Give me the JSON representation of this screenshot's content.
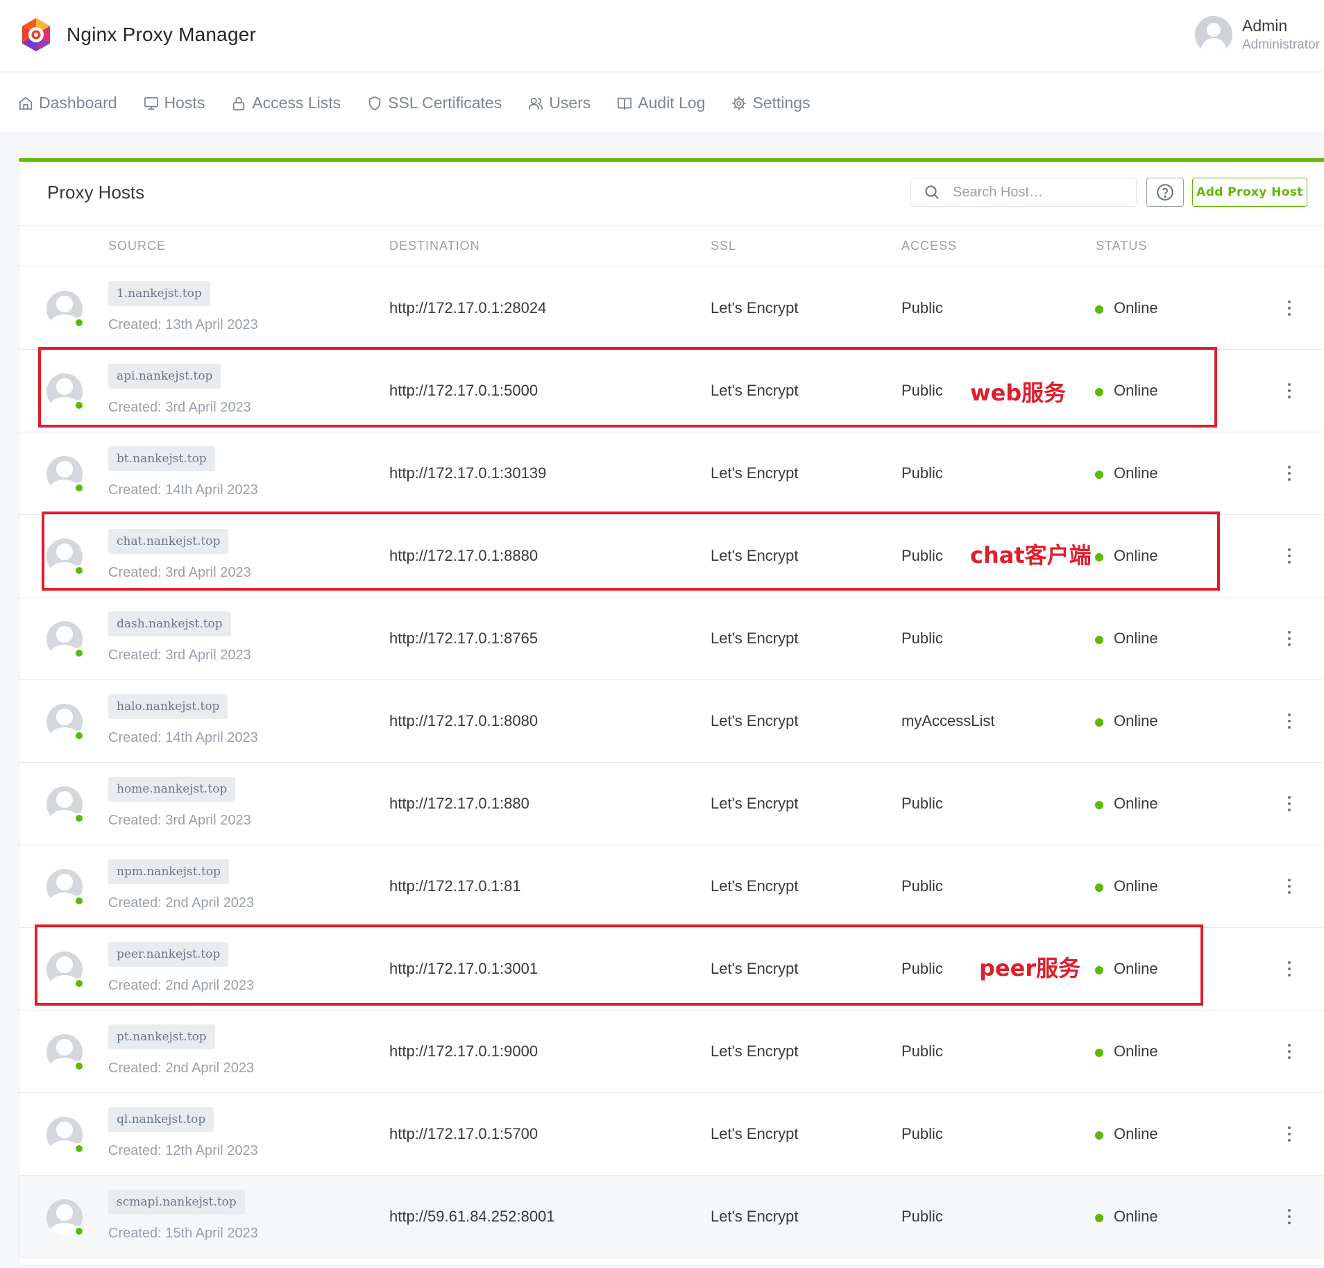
{
  "app": {
    "title": "Nginx Proxy Manager"
  },
  "user": {
    "name": "Admin",
    "role": "Administrator"
  },
  "nav": {
    "items": [
      {
        "label": "Dashboard",
        "icon": "home-icon"
      },
      {
        "label": "Hosts",
        "icon": "monitor-icon"
      },
      {
        "label": "Access Lists",
        "icon": "lock-icon"
      },
      {
        "label": "SSL Certificates",
        "icon": "shield-icon"
      },
      {
        "label": "Users",
        "icon": "users-icon"
      },
      {
        "label": "Audit Log",
        "icon": "book-icon"
      },
      {
        "label": "Settings",
        "icon": "gear-icon"
      }
    ]
  },
  "card": {
    "title": "Proxy Hosts",
    "search_placeholder": "Search Host…",
    "add_label": "Add Proxy Host"
  },
  "table": {
    "columns": [
      "SOURCE",
      "DESTINATION",
      "SSL",
      "ACCESS",
      "STATUS"
    ],
    "rows": [
      {
        "domain": "1.nankejst.top",
        "created": "Created: 13th April 2023",
        "destination": "http://172.17.0.1:28024",
        "ssl": "Let's Encrypt",
        "access": "Public",
        "status": "Online"
      },
      {
        "domain": "api.nankejst.top",
        "created": "Created: 3rd April 2023",
        "destination": "http://172.17.0.1:5000",
        "ssl": "Let's Encrypt",
        "access": "Public",
        "status": "Online"
      },
      {
        "domain": "bt.nankejst.top",
        "created": "Created: 14th April 2023",
        "destination": "http://172.17.0.1:30139",
        "ssl": "Let's Encrypt",
        "access": "Public",
        "status": "Online"
      },
      {
        "domain": "chat.nankejst.top",
        "created": "Created: 3rd April 2023",
        "destination": "http://172.17.0.1:8880",
        "ssl": "Let's Encrypt",
        "access": "Public",
        "status": "Online"
      },
      {
        "domain": "dash.nankejst.top",
        "created": "Created: 3rd April 2023",
        "destination": "http://172.17.0.1:8765",
        "ssl": "Let's Encrypt",
        "access": "Public",
        "status": "Online"
      },
      {
        "domain": "halo.nankejst.top",
        "created": "Created: 14th April 2023",
        "destination": "http://172.17.0.1:8080",
        "ssl": "Let's Encrypt",
        "access": "myAccessList",
        "status": "Online"
      },
      {
        "domain": "home.nankejst.top",
        "created": "Created: 3rd April 2023",
        "destination": "http://172.17.0.1:880",
        "ssl": "Let's Encrypt",
        "access": "Public",
        "status": "Online"
      },
      {
        "domain": "npm.nankejst.top",
        "created": "Created: 2nd April 2023",
        "destination": "http://172.17.0.1:81",
        "ssl": "Let's Encrypt",
        "access": "Public",
        "status": "Online"
      },
      {
        "domain": "peer.nankejst.top",
        "created": "Created: 2nd April 2023",
        "destination": "http://172.17.0.1:3001",
        "ssl": "Let's Encrypt",
        "access": "Public",
        "status": "Online"
      },
      {
        "domain": "pt.nankejst.top",
        "created": "Created: 2nd April 2023",
        "destination": "http://172.17.0.1:9000",
        "ssl": "Let's Encrypt",
        "access": "Public",
        "status": "Online"
      },
      {
        "domain": "ql.nankejst.top",
        "created": "Created: 12th April 2023",
        "destination": "http://172.17.0.1:5700",
        "ssl": "Let's Encrypt",
        "access": "Public",
        "status": "Online"
      },
      {
        "domain": "scmapi.nankejst.top",
        "created": "Created: 15th April 2023",
        "destination": "http://59.61.84.252:8001",
        "ssl": "Let's Encrypt",
        "access": "Public",
        "status": "Online"
      }
    ]
  },
  "annotations": [
    {
      "label": "web服务",
      "row": 1
    },
    {
      "label": "chat客户端",
      "row": 3
    },
    {
      "label": "peer服务",
      "row": 8
    }
  ],
  "colors": {
    "accent": "#5eba00",
    "annotation": "#e11d2b"
  }
}
